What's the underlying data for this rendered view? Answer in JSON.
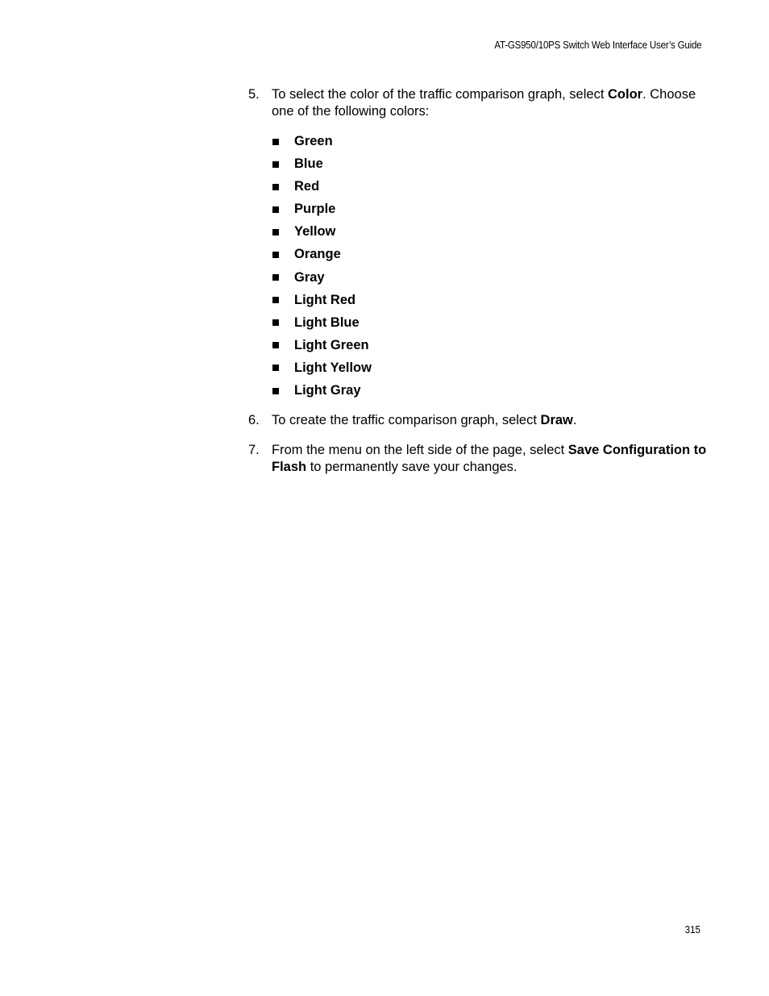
{
  "header": {
    "running_title": "AT-GS950/10PS Switch Web Interface User’s Guide"
  },
  "steps": [
    {
      "number": "5.",
      "text_before": "To select the color of the traffic comparison graph, select ",
      "bold": "Color",
      "text_after": ". Choose one of the following colors:"
    },
    {
      "number": "6.",
      "text_before": "To create the traffic comparison graph, select ",
      "bold": "Draw",
      "text_after": "."
    },
    {
      "number": "7.",
      "text_before": "From the menu on the left side of the page, select ",
      "bold": "Save Configuration to Flash",
      "text_after": " to permanently save your changes."
    }
  ],
  "color_options": [
    "Green",
    "Blue",
    "Red",
    "Purple",
    "Yellow",
    "Orange",
    "Gray",
    "Light Red",
    "Light Blue",
    "Light Green",
    "Light Yellow",
    "Light Gray"
  ],
  "footer": {
    "page_number": "315"
  }
}
